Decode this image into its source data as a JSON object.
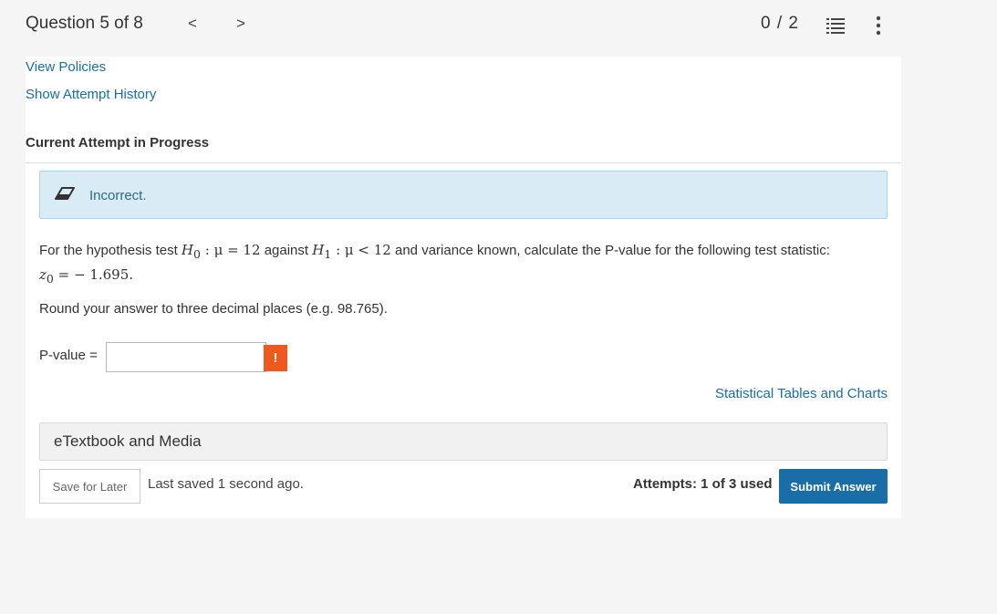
{
  "header": {
    "question_label": "Question 5 of 8",
    "prev_glyph": "<",
    "next_glyph": ">",
    "score": "0 / 2"
  },
  "links": {
    "view_policies": "View Policies",
    "show_attempt_history": "Show Attempt History"
  },
  "section_title": "Current Attempt in Progress",
  "feedback": {
    "text": "Incorrect.",
    "colors": {
      "background": "#d9ecf6",
      "border": "#a9d3ea",
      "text": "#2b6a95"
    }
  },
  "question": {
    "intro": "For the hypothesis test",
    "h0": "H",
    "h0_sub": "0",
    "h0_rest": ": μ = 12",
    "against": "against",
    "h1": "H",
    "h1_sub": "1",
    "h1_rest": ": μ < 12",
    "after": "and variance known, calculate the P-value for the following test statistic:",
    "z_symbol": "z",
    "z_sub": "0",
    "z_value": "= − 1.695.",
    "instruction": "Round your answer to three decimal places (e.g. 98.765)."
  },
  "answer": {
    "label": "P-value =",
    "value": "",
    "warning_glyph": "!"
  },
  "stat_tables_link": "Statistical Tables and Charts",
  "etextbook": "eTextbook and Media",
  "footer": {
    "save_label": "Save for Later",
    "last_saved": "Last saved 1 second ago.",
    "attempts": "Attempts: 1 of 3 used",
    "submit_label": "Submit Answer"
  },
  "colors": {
    "accent": "#1a6ea8",
    "warning": "#f0591e"
  },
  "icons": {
    "prev": "chevron-left-icon",
    "next": "chevron-right-icon",
    "list": "list-icon",
    "more": "more-vertical-icon",
    "feedback": "eraser-icon"
  }
}
